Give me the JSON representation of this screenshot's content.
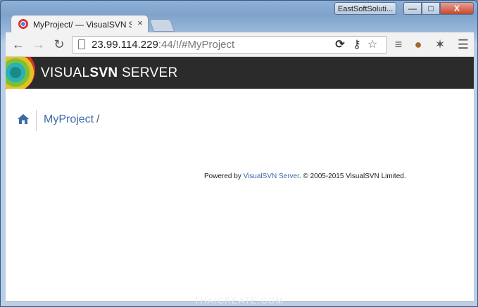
{
  "window": {
    "user_label": "EastSoftSoluti...",
    "min_label": "—",
    "max_label": "□",
    "close_label": "X"
  },
  "tab": {
    "title": "MyProject/ — VisualSVN S",
    "close_label": "×"
  },
  "toolbar": {
    "url_host": "23.99.114.229",
    "url_rest": ":44/!/#MyProject"
  },
  "header": {
    "brand_light": "VISUAL",
    "brand_bold": "SVN",
    "brand_tail": " SERVER"
  },
  "breadcrumb": {
    "link": "MyProject",
    "slash": "/"
  },
  "footer": {
    "prefix": "Powered by ",
    "link": "VisualSVN Server",
    "suffix": ". © 2005-2015 VisualSVN Limited."
  },
  "watermark": "THAICREATE.COM",
  "colors": {
    "header_bg": "#2b2b2b",
    "link": "#3c6aa8"
  },
  "icons": [
    "back-icon",
    "forward-icon",
    "reload-icon",
    "page-icon",
    "sync-icon",
    "key-icon",
    "star-icon",
    "cookie-icon",
    "bug-icon",
    "menu-icon",
    "home-icon"
  ]
}
